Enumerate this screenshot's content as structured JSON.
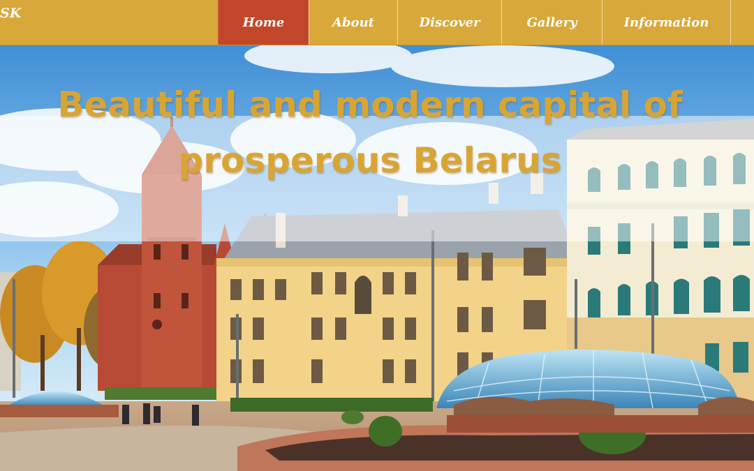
{
  "site": {
    "logo": "SK"
  },
  "nav": {
    "items": [
      {
        "label": "Home",
        "active": true
      },
      {
        "label": "About",
        "active": false
      },
      {
        "label": "Discover",
        "active": false
      },
      {
        "label": "Gallery",
        "active": false
      },
      {
        "label": "Information",
        "active": false
      }
    ]
  },
  "hero": {
    "headline": "Beautiful and modern capital of prosperous Belarus",
    "image": "city-square-with-red-church-and-yellow-buildings"
  },
  "colors": {
    "nav_bg": "#d9a83a",
    "nav_active": "#c2472a",
    "headline": "#d8a535"
  }
}
